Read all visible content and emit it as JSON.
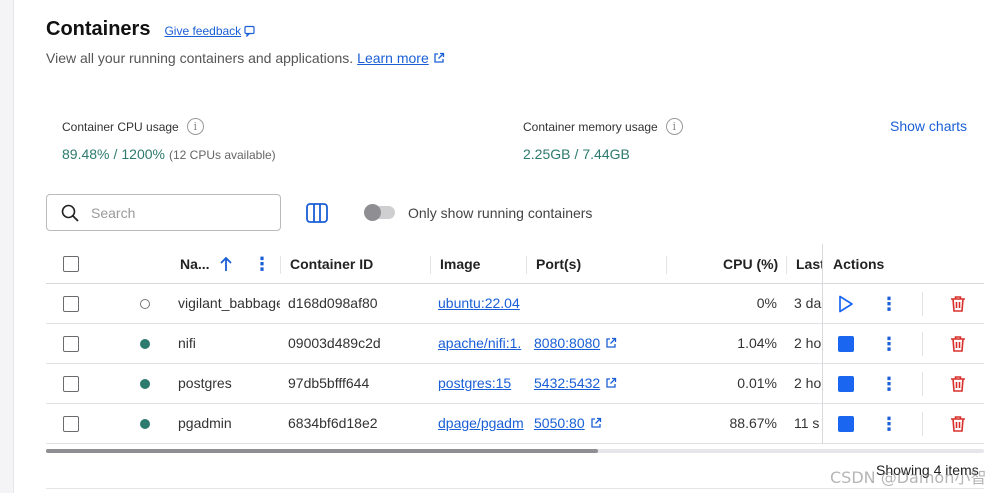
{
  "header": {
    "title": "Containers",
    "feedback_label": "Give feedback",
    "subtitle": "View all your running containers and applications.",
    "learn_more": "Learn more"
  },
  "stats": {
    "cpu": {
      "label": "Container CPU usage",
      "value": "89.48%",
      "separator": "/",
      "total": "1200%",
      "note": "(12 CPUs available)"
    },
    "memory": {
      "label": "Container memory usage",
      "value": "2.25GB",
      "separator": "/",
      "total": "7.44GB"
    },
    "show_charts": "Show charts"
  },
  "toolbar": {
    "search_placeholder": "Search",
    "toggle_label": "Only show running containers",
    "toggle_on": false
  },
  "table": {
    "columns": {
      "name": "Na...",
      "container_id": "Container ID",
      "image": "Image",
      "ports": "Port(s)",
      "cpu": "CPU (%)",
      "last": "Last",
      "actions": "Actions"
    },
    "rows": [
      {
        "name": "vigilant_babbage",
        "status": "stopped",
        "id": "d168d098af80",
        "image": "ubuntu:22.04",
        "port": "",
        "cpu": "0%",
        "last": "3 da"
      },
      {
        "name": "nifi",
        "status": "running",
        "id": "09003d489c2d",
        "image": "apache/nifi:1.",
        "port": "8080:8080",
        "cpu": "1.04%",
        "last": "2 ho"
      },
      {
        "name": "postgres",
        "status": "running",
        "id": "97db5bfff644",
        "image": "postgres:15",
        "port": "5432:5432",
        "cpu": "0.01%",
        "last": "2 ho"
      },
      {
        "name": "pgadmin",
        "status": "running",
        "id": "6834bf6d18e2",
        "image": "dpage/pgadm",
        "port": "5050:80",
        "cpu": "88.67%",
        "last": "11 s"
      }
    ]
  },
  "footer": {
    "count": "Showing 4 items"
  },
  "watermark": "CSDN @Damon小智",
  "colors": {
    "accent": "#1a5fd6",
    "running": "#2d7a6e",
    "delete": "#d9302c",
    "stop": "#1a66f0"
  }
}
